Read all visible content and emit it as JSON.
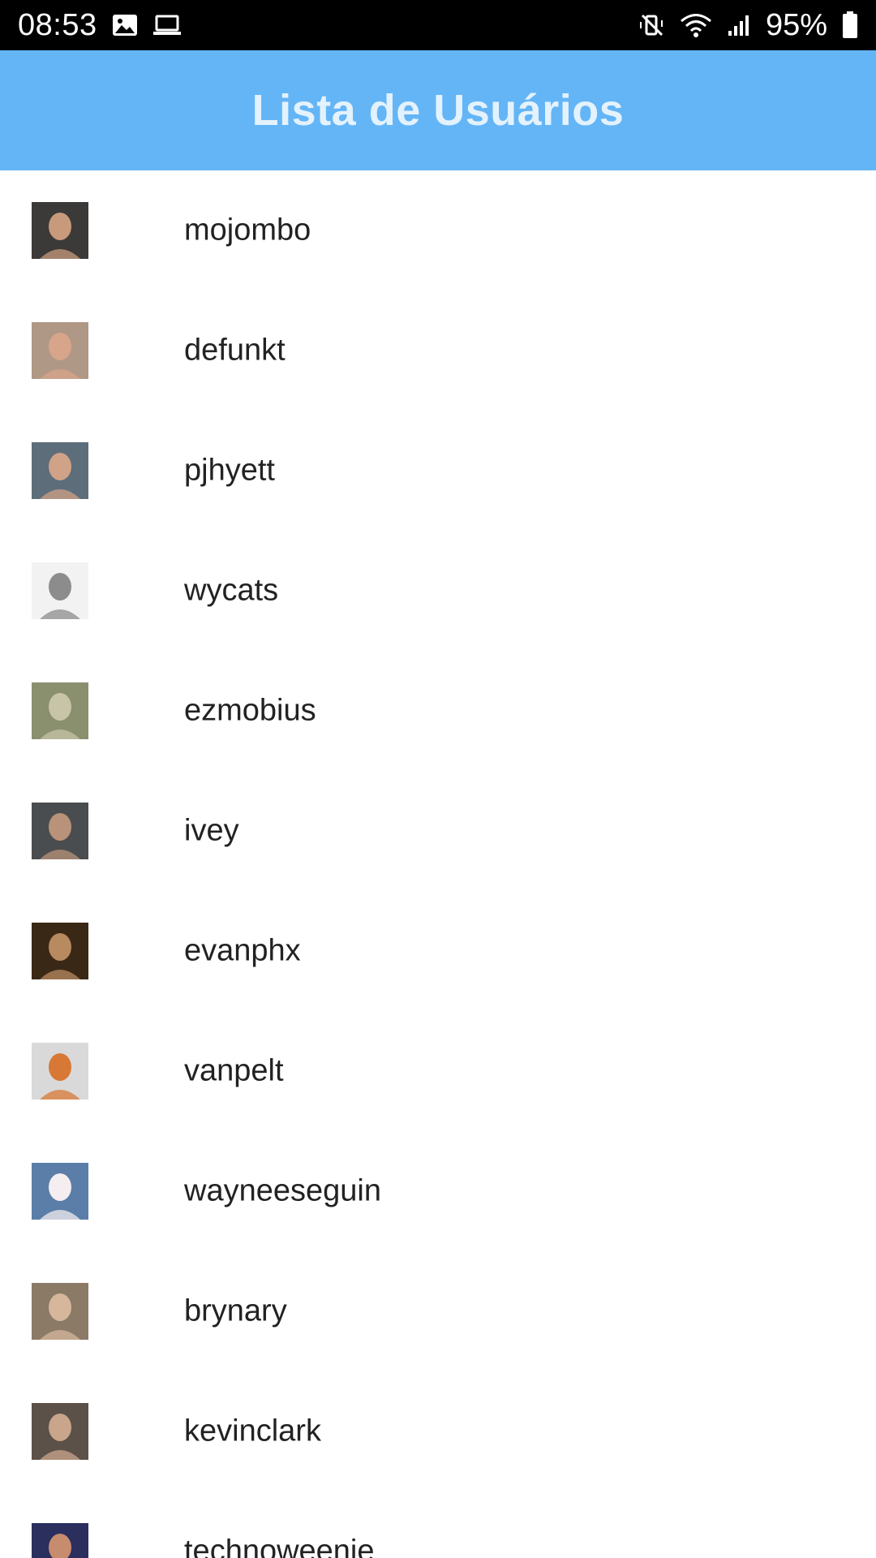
{
  "status_bar": {
    "time": "08:53",
    "battery": "95%",
    "left_icons": [
      "image-icon",
      "laptop-icon"
    ],
    "right_icons": [
      "mute-vibrate-icon",
      "wifi-icon",
      "signal-icon",
      "battery-icon"
    ]
  },
  "app_bar": {
    "title": "Lista de Usuários",
    "color": "#64b5f6",
    "title_color": "#e3f2fd"
  },
  "users": [
    {
      "login": "mojombo",
      "avatar_bg": "#3b3a38",
      "avatar_face": "#c89a7c"
    },
    {
      "login": "defunkt",
      "avatar_bg": "#b09886",
      "avatar_face": "#d7a58a"
    },
    {
      "login": "pjhyett",
      "avatar_bg": "#5d6d7a",
      "avatar_face": "#d0a287"
    },
    {
      "login": "wycats",
      "avatar_bg": "#f2f2f2",
      "avatar_face": "#8c8c8c"
    },
    {
      "login": "ezmobius",
      "avatar_bg": "#8a8f6e",
      "avatar_face": "#c8c4a8"
    },
    {
      "login": "ivey",
      "avatar_bg": "#4a4d4f",
      "avatar_face": "#b8937a"
    },
    {
      "login": "evanphx",
      "avatar_bg": "#3a2816",
      "avatar_face": "#b88a60"
    },
    {
      "login": "vanpelt",
      "avatar_bg": "#d9d9d9",
      "avatar_face": "#d77836"
    },
    {
      "login": "wayneeseguin",
      "avatar_bg": "#5a7ea8",
      "avatar_face": "#f4eef0"
    },
    {
      "login": "brynary",
      "avatar_bg": "#8a7a66",
      "avatar_face": "#d6b79c"
    },
    {
      "login": "kevinclark",
      "avatar_bg": "#5b5149",
      "avatar_face": "#c9a58c"
    },
    {
      "login": "technoweenie",
      "avatar_bg": "#2b2f5e",
      "avatar_face": "#c78b6e"
    }
  ]
}
